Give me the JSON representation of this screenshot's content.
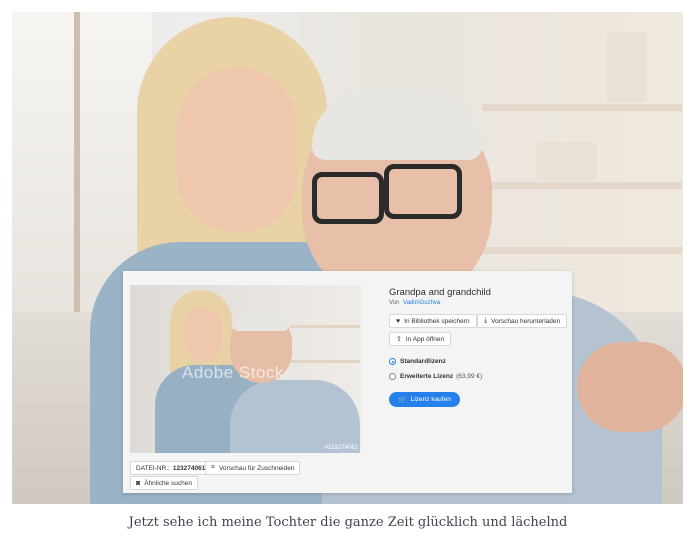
{
  "stock": {
    "title": "Grandpa and grandchild",
    "by_label": "Von",
    "author": "VadimGuzhva",
    "watermark": "Adobe Stock",
    "image_id_mark": "#123274061",
    "file_no_label": "DATEI-NR.:",
    "file_no": "123274061",
    "crop_preview_label": "Vorschau für Zuschneiden",
    "similar_label": "Ähnliche suchen",
    "save_library_label": "In Bibliothek speichern",
    "download_preview_label": "Vorschau herunterladen",
    "open_in_app_label": "In App öffnen",
    "license_standard_label": "Standardlizenz",
    "license_extended_label": "Erweiterte Lizenz",
    "license_extended_price": "(63,99 €)",
    "buy_label": "Lizenz kaufen",
    "selected_license": "Standardlizenz",
    "accent_color": "#2680eb"
  },
  "caption": "Jetzt sehe ich meine Tochter die ganze Zeit glücklich und lächelnd"
}
